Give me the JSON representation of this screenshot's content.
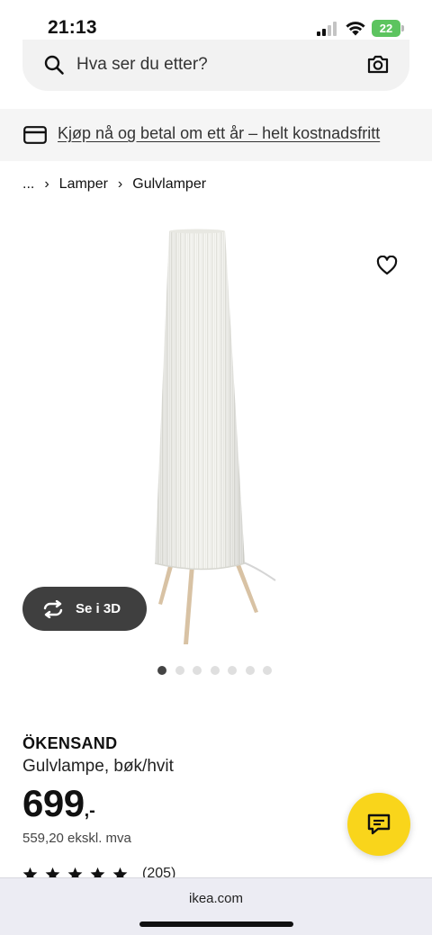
{
  "status_bar": {
    "time": "21:13",
    "battery": "22"
  },
  "search": {
    "placeholder": "Hva ser du etter?"
  },
  "promo": {
    "text": "Kjøp nå og betal om ett år – helt kostnadsfritt"
  },
  "breadcrumb": {
    "ellipsis": "...",
    "items": [
      "Lamper",
      "Gulvlamper"
    ]
  },
  "gallery": {
    "view_3d_label": "Se i 3D",
    "dot_count": 7,
    "active_dot": 1
  },
  "product": {
    "name": "ÖKENSAND",
    "description": "Gulvlampe, bøk/hvit",
    "price": "699",
    "price_suffix": ",-",
    "price_excl_vat": "559,20 ekskl. mva",
    "rating_stars": 5,
    "review_count": "(205)"
  },
  "browser": {
    "url": "ikea.com"
  },
  "colors": {
    "accent_yellow": "#f9d51b",
    "dark_button": "#3f3f3f",
    "battery_green": "#5cc45f"
  },
  "icons": [
    "signal-icon",
    "wifi-icon",
    "search-icon",
    "camera-icon",
    "card-icon",
    "heart-icon",
    "rotate-icon",
    "star-icon",
    "chat-icon"
  ]
}
